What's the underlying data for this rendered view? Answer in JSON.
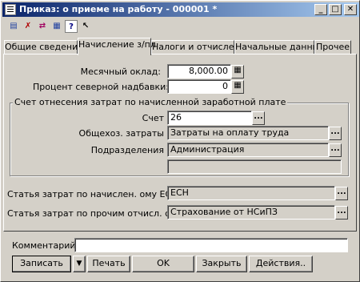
{
  "window": {
    "title": "Приказ: о приеме на работу - 000001 *",
    "controls": [
      "_",
      "□",
      "✕"
    ]
  },
  "toolbar": {
    "icons": [
      "doc-struct-icon",
      "delete-icon",
      "move-icon",
      "new-row-icon",
      "help-icon",
      "help-cursor-icon"
    ],
    "glyphs": [
      "▤",
      "✗",
      "⇄",
      "▦",
      "?",
      "↖"
    ]
  },
  "tabs": [
    {
      "label": "Общие сведения"
    },
    {
      "label": "Начисление з/пл"
    },
    {
      "label": "Налоги и отчисления"
    },
    {
      "label": "Начальные данные"
    },
    {
      "label": "Прочее"
    }
  ],
  "active_tab": "Начисление з/пл",
  "form": {
    "salary_label": "Месячный оклад:",
    "salary_value": "8,000.00",
    "north_label": "Процент северной надбавки:",
    "north_value": "0",
    "group_title": "Счет отнесения затрат по начисленной заработной плате",
    "account_label": "Счет",
    "account_value": "26",
    "costs_label": "Общехоз. затраты",
    "costs_value": "Затраты на оплату труда",
    "division_label": "Подразделения",
    "division_value": "Администрация",
    "extra_value": "",
    "esn_label": "Статья затрат по начислен. ому ЕСН",
    "esn_value": "ЕСН",
    "other_label": "Статья затрат по прочим отчисл. с ФОТ",
    "other_value": "Страхование от НСиПЗ"
  },
  "comment": {
    "label": "Комментарий:",
    "value": ""
  },
  "buttons": {
    "save": "Записать",
    "dropdown": "▼",
    "print": "Печать",
    "ok": "OK",
    "close": "Закрыть",
    "actions": "Действия.."
  },
  "glyphs": {
    "calc": "▦",
    "ellipsis": "..."
  }
}
